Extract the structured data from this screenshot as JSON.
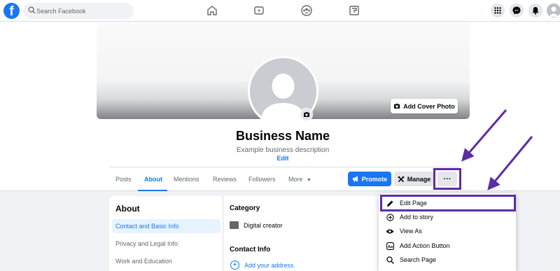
{
  "nav": {
    "search_placeholder": "Search Facebook",
    "logo_letter": "f"
  },
  "profile": {
    "add_cover_label": "Add Cover Photo",
    "business_name": "Business Name",
    "description": "Example business description",
    "edit_label": "Edit"
  },
  "tabs": [
    {
      "label": "Posts"
    },
    {
      "label": "About"
    },
    {
      "label": "Mentions"
    },
    {
      "label": "Reviews"
    },
    {
      "label": "Followers"
    },
    {
      "label": "More"
    }
  ],
  "actions": {
    "promote_label": "Promote",
    "manage_label": "Manage",
    "more_label": "···"
  },
  "about": {
    "title": "About",
    "items": [
      {
        "label": "Contact and Basic Info"
      },
      {
        "label": "Privacy and Legal Info"
      },
      {
        "label": "Work and Education"
      }
    ]
  },
  "main": {
    "category_title": "Category",
    "category_value": "Digital creator",
    "contact_title": "Contact Info",
    "add_address": "Add your address"
  },
  "dropdown": {
    "items": [
      {
        "label": "Edit Page",
        "icon": "pencil-icon"
      },
      {
        "label": "Add to story",
        "icon": "plus-circle-icon"
      },
      {
        "label": "View As",
        "icon": "eye-icon"
      },
      {
        "label": "Add Action Button",
        "icon": "action-button-icon"
      },
      {
        "label": "Search Page",
        "icon": "search-icon"
      }
    ]
  },
  "colors": {
    "brand": "#1877f2",
    "annotation": "#5b2ea6"
  }
}
